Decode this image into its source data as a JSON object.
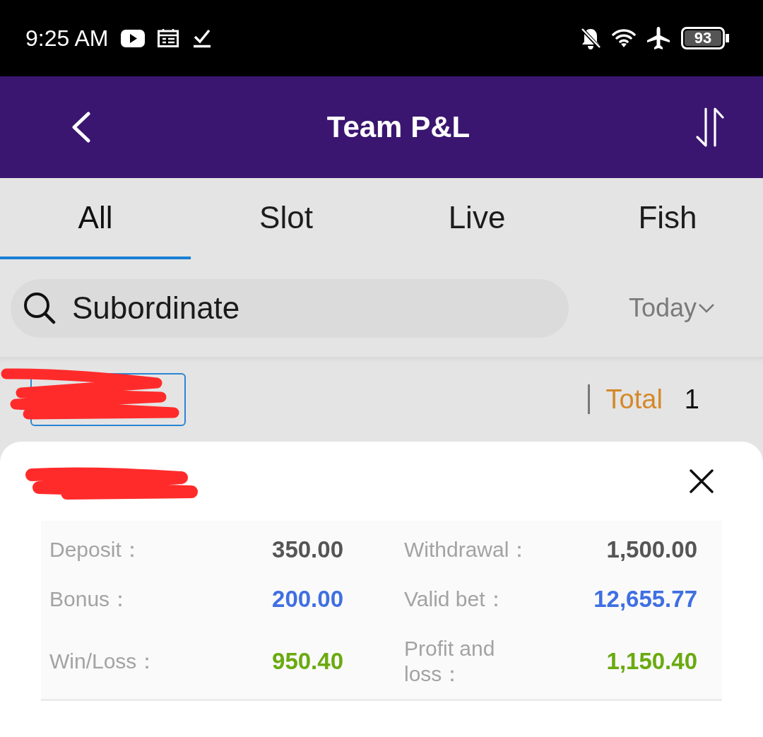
{
  "status_bar": {
    "time": "9:25 AM",
    "battery": "93"
  },
  "header": {
    "title": "Team P&L"
  },
  "tabs": [
    {
      "label": "All",
      "selected": true
    },
    {
      "label": "Slot",
      "selected": false
    },
    {
      "label": "Live",
      "selected": false
    },
    {
      "label": "Fish",
      "selected": false
    }
  ],
  "search": {
    "placeholder": "Subordinate"
  },
  "date_filter": {
    "label": "Today"
  },
  "summary": {
    "chip_redacted": true,
    "total_label": "Total",
    "total_value": "1"
  },
  "member_card": {
    "name_redacted": true,
    "stats": [
      {
        "label": "Deposit：",
        "value": "350.00",
        "color": "#555555"
      },
      {
        "label": "Withdrawal：",
        "value": "1,500.00",
        "color": "#555555"
      },
      {
        "label": "Bonus：",
        "value": "200.00",
        "color": "#3f6fe2"
      },
      {
        "label": "Valid bet：",
        "value": "12,655.77",
        "color": "#3f6fe2"
      },
      {
        "label": "Win/Loss：",
        "value": "950.40",
        "color": "#6aaa10"
      },
      {
        "label": "Profit and loss：",
        "value": "1,150.40",
        "color": "#6aaa10"
      }
    ]
  }
}
